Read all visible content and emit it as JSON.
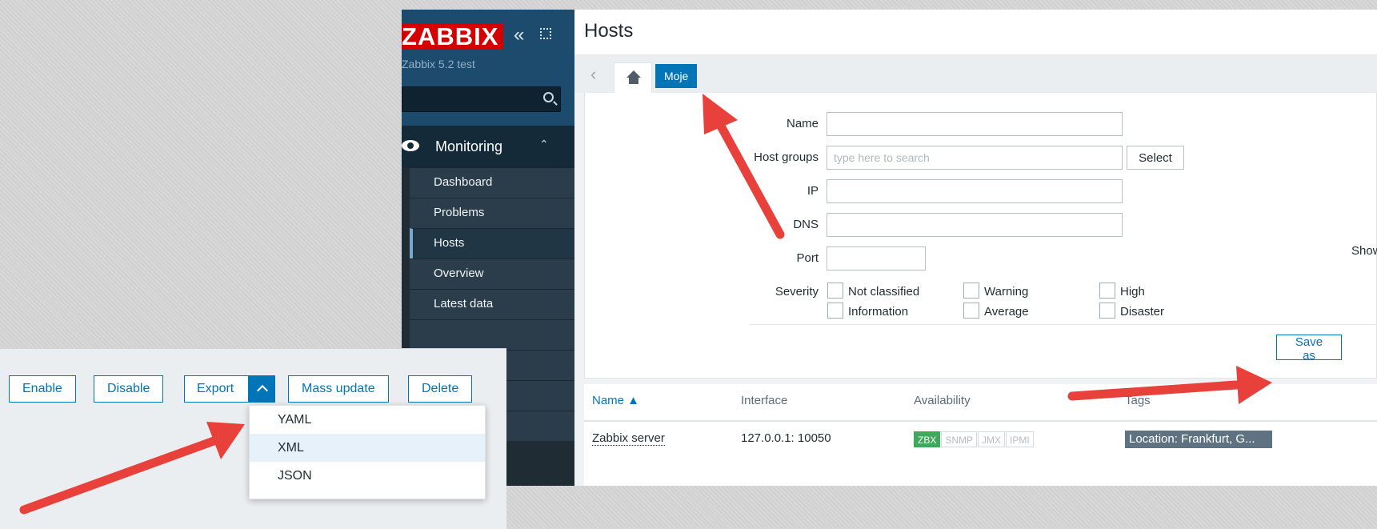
{
  "sidebar": {
    "logo": "ZABBIX",
    "server_name": "Zabbix 5.2 test",
    "monitoring_label": "Monitoring",
    "items": [
      {
        "label": "Dashboard"
      },
      {
        "label": "Problems"
      },
      {
        "label": "Hosts"
      },
      {
        "label": "Overview"
      },
      {
        "label": "Latest data"
      }
    ]
  },
  "header": {
    "title": "Hosts"
  },
  "tabs": {
    "saved_filter": "Moje"
  },
  "filter": {
    "name_label": "Name",
    "host_groups_label": "Host groups",
    "host_groups_placeholder": "type here to search",
    "select_button": "Select",
    "ip_label": "IP",
    "dns_label": "DNS",
    "port_label": "Port",
    "severity_label": "Severity",
    "severities": [
      "Not classified",
      "Warning",
      "High",
      "Information",
      "Average",
      "Disaster"
    ],
    "show_label": "Show",
    "save_as_button": "Save as"
  },
  "table": {
    "headers": {
      "name": "Name ▲",
      "interface": "Interface",
      "availability": "Availability",
      "tags": "Tags"
    },
    "rows": [
      {
        "name": "Zabbix server",
        "interface": "127.0.0.1: 10050",
        "availability": [
          "ZBX",
          "SNMP",
          "JMX",
          "IPMI"
        ],
        "tag": "Location: Frankfurt, G..."
      }
    ]
  },
  "actions": {
    "enable": "Enable",
    "disable": "Disable",
    "export": "Export",
    "mass_update": "Mass update",
    "delete": "Delete",
    "export_formats": [
      "YAML",
      "XML",
      "JSON"
    ]
  },
  "colors": {
    "accent": "#0275b8",
    "brand_red": "#d40000",
    "sidebar": "#1f2c33",
    "arrow": "#e8403a",
    "available_green": "#3ea85b"
  }
}
